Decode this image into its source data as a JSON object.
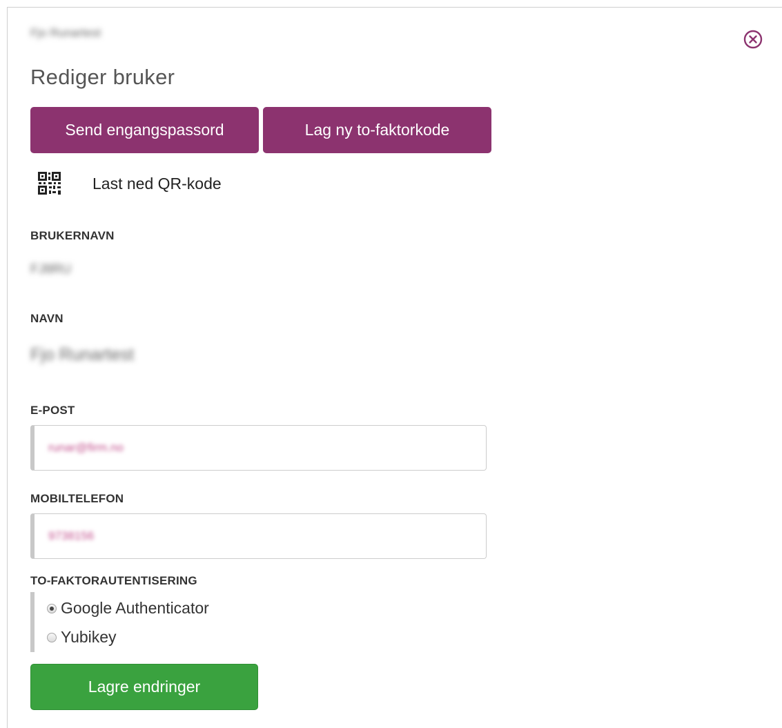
{
  "header": {
    "user_display_name": "Fjo Runartest",
    "title": "Rediger bruker"
  },
  "actions": {
    "send_otp_label": "Send engangspassord",
    "new_2fa_label": "Lag ny to-faktorkode",
    "download_qr_label": "Last ned QR-kode"
  },
  "fields": {
    "username_label": "BRUKERNAVN",
    "username_value": "FJ8RU",
    "name_label": "NAVN",
    "name_value": "Fjo Runartest",
    "email_label": "E-POST",
    "email_value": "runar@firm.no",
    "mobile_label": "MOBILTELEFON",
    "mobile_value": "9738156"
  },
  "two_factor": {
    "label": "TO-FAKTORAUTENTISERING",
    "options": [
      {
        "label": "Google Authenticator",
        "selected": true
      },
      {
        "label": "Yubikey",
        "selected": false
      }
    ]
  },
  "footer": {
    "save_label": "Lagre endringer"
  },
  "colors": {
    "primary": "#8c336f",
    "success": "#3aa23f"
  },
  "icons": {
    "close": "close-circle-icon",
    "qr": "qr-code-icon"
  }
}
